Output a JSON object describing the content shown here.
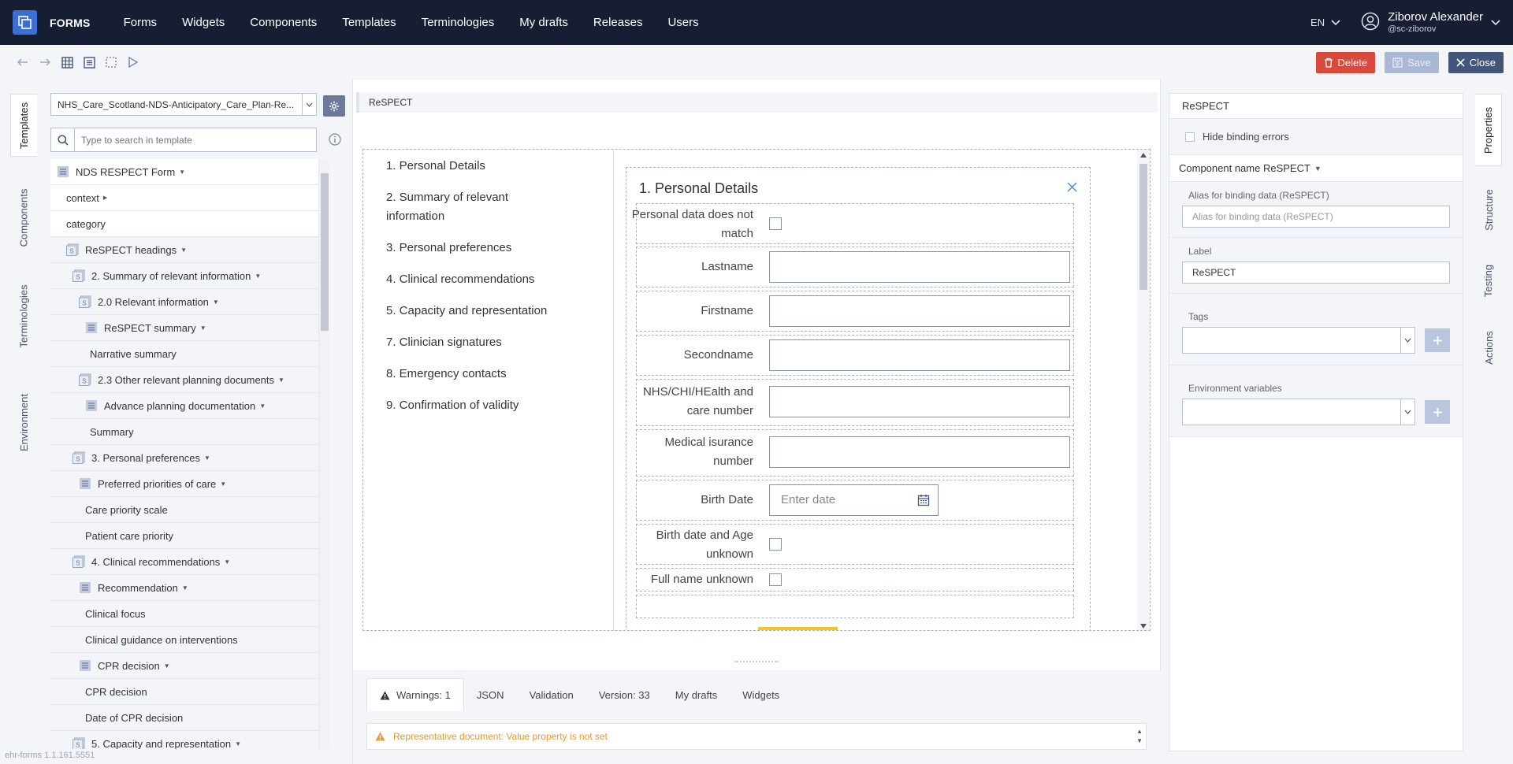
{
  "app": {
    "brand": "FORMS"
  },
  "nav": {
    "items": [
      "Forms",
      "Widgets",
      "Components",
      "Templates",
      "Terminologies",
      "My drafts",
      "Releases",
      "Users"
    ]
  },
  "user": {
    "lang": "EN",
    "name": "Ziborov Alexander",
    "handle": "@sc-ziborov"
  },
  "toolbar": {
    "delete_label": "Delete",
    "save_label": "Save",
    "close_label": "Close"
  },
  "left_tabs": [
    "Templates",
    "Components",
    "Terminologies",
    "Environment"
  ],
  "right_tabs": [
    "Properties",
    "Structure",
    "Testing",
    "Actions"
  ],
  "template_panel": {
    "selected_template": "NHS_Care_Scotland-NDS-Anticipatory_Care_Plan-Re...",
    "search_placeholder": "Type to search in template",
    "tree": [
      {
        "label": "NDS RESPECT Form",
        "level": 0,
        "icon": "list",
        "caret": true
      },
      {
        "label": "context",
        "level": 1,
        "icon": "",
        "caret": "right"
      },
      {
        "label": "category",
        "level": 1,
        "icon": "",
        "caret": false
      },
      {
        "label": "ReSPECT headings",
        "level": 1,
        "icon": "section",
        "caret": true
      },
      {
        "label": "2. Summary of relevant information",
        "level": 2,
        "icon": "section",
        "caret": true
      },
      {
        "label": "2.0 Relevant information",
        "level": 3,
        "icon": "section",
        "caret": true
      },
      {
        "label": "ReSPECT summary",
        "level": 4,
        "icon": "list",
        "caret": true
      },
      {
        "label": "Narrative summary",
        "level": 5,
        "icon": "",
        "caret": false
      },
      {
        "label": "2.3 Other relevant planning documents",
        "level": 3,
        "icon": "section",
        "caret": true
      },
      {
        "label": "Advance planning documentation",
        "level": 4,
        "icon": "list",
        "caret": true
      },
      {
        "label": "Summary",
        "level": 5,
        "icon": "",
        "caret": false
      },
      {
        "label": "3. Personal preferences",
        "level": 2,
        "icon": "section",
        "caret": true
      },
      {
        "label": "Preferred priorities of care",
        "level": 3,
        "icon": "list",
        "caret": true
      },
      {
        "label": "Care priority scale",
        "level": 4,
        "icon": "",
        "caret": false
      },
      {
        "label": "Patient care priority",
        "level": 4,
        "icon": "",
        "caret": false
      },
      {
        "label": "4. Clinical recommendations",
        "level": 2,
        "icon": "section",
        "caret": true
      },
      {
        "label": "Recommendation",
        "level": 3,
        "icon": "list",
        "caret": true
      },
      {
        "label": "Clinical focus",
        "level": 4,
        "icon": "",
        "caret": false
      },
      {
        "label": "Clinical guidance on interventions",
        "level": 4,
        "icon": "",
        "caret": false
      },
      {
        "label": "CPR decision",
        "level": 3,
        "icon": "list",
        "caret": true
      },
      {
        "label": "CPR decision",
        "level": 4,
        "icon": "",
        "caret": false
      },
      {
        "label": "Date of CPR decision",
        "level": 4,
        "icon": "",
        "caret": false
      },
      {
        "label": "5. Capacity and representation",
        "level": 2,
        "icon": "section",
        "caret": true
      }
    ]
  },
  "version": "ehr-forms 1.1.161.5551",
  "center": {
    "breadcrumb": "ReSPECT",
    "sections": [
      "1. Personal Details",
      "2. Summary of relevant information",
      "3. Personal preferences",
      "4. Clinical recommendations",
      "5. Capacity and representation",
      "7. Clinician signatures",
      "8. Emergency contacts",
      "9. Confirmation of validity"
    ],
    "form": {
      "title": "1. Personal Details",
      "fields": [
        {
          "label": "Personal data does not match",
          "type": "checkbox"
        },
        {
          "label": "Lastname",
          "type": "text"
        },
        {
          "label": "Firstname",
          "type": "text"
        },
        {
          "label": "Secondname",
          "type": "text"
        },
        {
          "label": "NHS/CHI/HEalth and care number",
          "type": "text"
        },
        {
          "label": "Medical isurance number",
          "type": "text"
        },
        {
          "label": "Birth Date",
          "type": "date",
          "placeholder": "Enter date"
        },
        {
          "label": "Birth date and Age unknown",
          "type": "checkbox"
        },
        {
          "label": "Full name unknown",
          "type": "checkbox"
        }
      ]
    }
  },
  "bottom": {
    "tabs": [
      "Warnings: 1",
      "JSON",
      "Validation",
      "Version: 33",
      "My drafts",
      "Widgets"
    ],
    "warning": "Representative document: Value property is not set"
  },
  "properties": {
    "title": "ReSPECT",
    "hide_binding_errors": "Hide binding errors",
    "component_name": "Component name ReSPECT",
    "alias_label": "Alias for binding data (ReSPECT)",
    "alias_placeholder": "Alias for binding data  (ReSPECT)",
    "label_label": "Label",
    "label_value": "ReSPECT",
    "tags_label": "Tags",
    "env_label": "Environment variables"
  },
  "colors": {
    "nav_bg": "#171d33",
    "accent": "#3b6fd8",
    "delete": "#d84a3b",
    "close": "#43557a",
    "warning": "#e89a2c"
  }
}
